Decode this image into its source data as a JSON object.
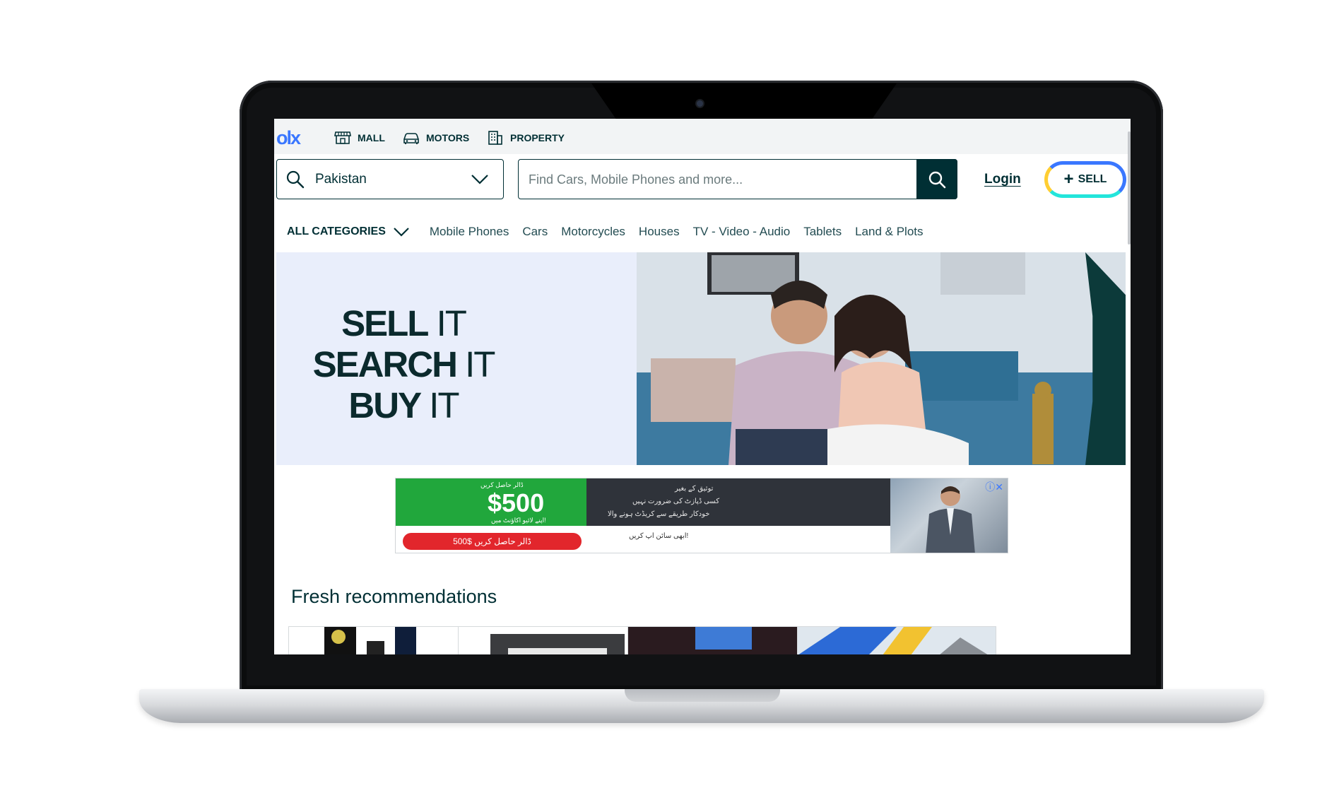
{
  "nav": {
    "logo": "olx",
    "items": [
      {
        "label": "MALL",
        "icon": "store-icon"
      },
      {
        "label": "MOTORS",
        "icon": "car-icon"
      },
      {
        "label": "PROPERTY",
        "icon": "building-icon"
      }
    ]
  },
  "search": {
    "location": "Pakistan",
    "placeholder": "Find Cars, Mobile Phones and more...",
    "login": "Login",
    "sell": "SELL"
  },
  "categories": {
    "all": "ALL CATEGORIES",
    "items": [
      "Mobile Phones",
      "Cars",
      "Motorcycles",
      "Houses",
      "TV - Video - Audio",
      "Tablets",
      "Land & Plots"
    ]
  },
  "hero": {
    "line1_bold": "SELL",
    "line1_thin": " IT",
    "line2_bold": "SEARCH",
    "line2_thin": " IT",
    "line3_bold": "BUY",
    "line3_thin": " IT"
  },
  "ad": {
    "price": "$500",
    "top_small": "ڈالر حاصل کریں",
    "bottom_small": "اپنے لائیو اکاؤنٹ میں!",
    "cta": "ڈالر حاصل کریں $500",
    "line1": "توثیق کے بغیر",
    "line2": "کسی ڈپازٹ کی ضرورت نہیں",
    "line3": "خودکار طریقے سے کریڈٹ ہونے والا",
    "signup": "ابھی سائن اپ کریں!"
  },
  "fresh": {
    "title": "Fresh recommendations"
  },
  "colors": {
    "primary": "#002f34",
    "brand_blue": "#3a77ff",
    "sell_yellow": "#ffce32",
    "sell_teal": "#23e5db",
    "hero_blue": "#2f62e3"
  }
}
